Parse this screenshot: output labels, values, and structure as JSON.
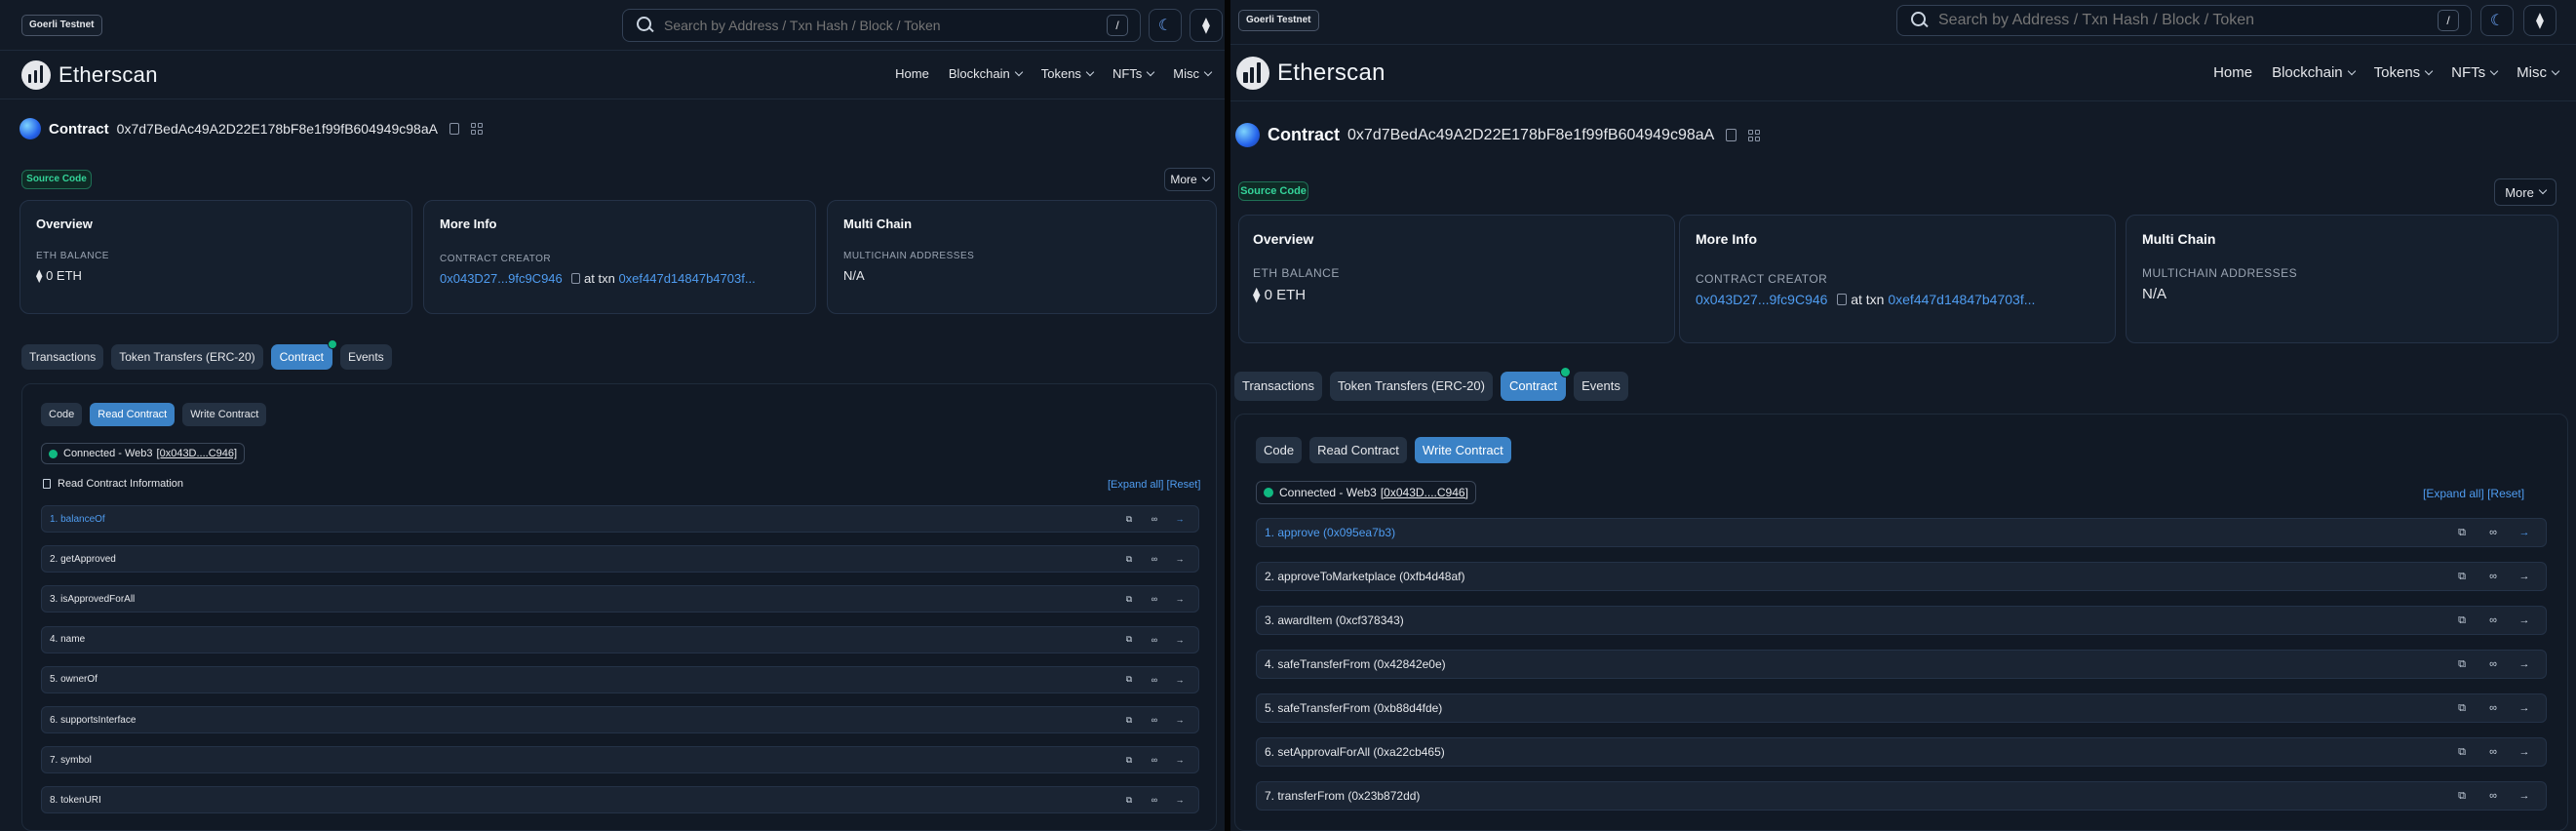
{
  "network_badge": "Goerli Testnet",
  "search_placeholder": "Search by Address / Txn Hash / Block / Token",
  "search_shortcut": "/",
  "logo_text": "Etherscan",
  "nav": [
    "Home",
    "Blockchain",
    "Tokens",
    "NFTs",
    "Misc"
  ],
  "contract_label": "Contract",
  "contract_address": "0x7d7BedAc49A2D22E178bF8e1f99fB604949c98aA",
  "source_badge": "Source Code",
  "more_label": "More",
  "overview": {
    "title": "Overview",
    "balance_label": "ETH BALANCE",
    "balance_value": "0 ETH",
    "eth_glyph": "⧫"
  },
  "more_info": {
    "title": "More Info",
    "creator_label": "CONTRACT CREATOR",
    "creator": "0x043D27...9fc9C946",
    "at_txn": "at txn",
    "txn": "0xef447d14847b4703f..."
  },
  "multichain": {
    "title": "Multi Chain",
    "label": "MULTICHAIN ADDRESSES",
    "value": "N/A"
  },
  "tabs": [
    "Transactions",
    "Token Transfers (ERC-20)",
    "Contract",
    "Events"
  ],
  "active_tab": "Contract",
  "subtabs": [
    "Code",
    "Read Contract",
    "Write Contract"
  ],
  "connected_text": "Connected - Web3",
  "connected_addr": "[0x043D....C946]",
  "read_info_label": "Read Contract Information",
  "expand_all": "[Expand all]",
  "reset": "[Reset]",
  "left_active_subtab": "Read Contract",
  "right_active_subtab": "Write Contract",
  "read_functions": [
    "1. balanceOf",
    "2. getApproved",
    "3. isApprovedForAll",
    "4. name",
    "5. ownerOf",
    "6. supportsInterface",
    "7. symbol",
    "8. tokenURI"
  ],
  "write_functions": [
    "1. approve (0x095ea7b3)",
    "2. approveToMarketplace (0xfb4d48af)",
    "3. awardItem (0xcf378343)",
    "4. safeTransferFrom (0x42842e0e)",
    "5. safeTransferFrom (0xb88d4fde)",
    "6. setApprovalForAll (0xa22cb465)",
    "7. transferFrom (0x23b872dd)"
  ],
  "icons": {
    "search": "search-icon",
    "theme": "moon-icon",
    "eth": "ethereum-icon",
    "copy": "copy-icon",
    "qr": "qr-code-icon",
    "link": "link-icon",
    "arrow": "arrow-right-icon"
  }
}
